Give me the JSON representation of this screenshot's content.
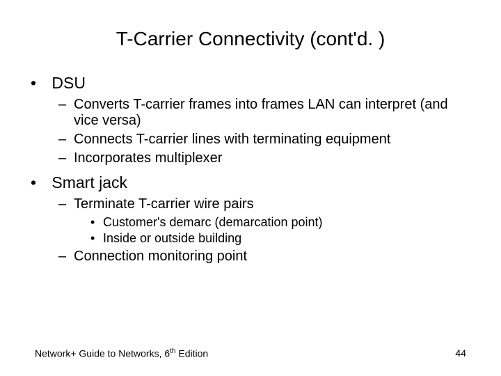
{
  "title": "T-Carrier Connectivity (cont'd. )",
  "bullets": [
    {
      "text": "DSU",
      "children": [
        {
          "text": "Converts T-carrier frames into frames LAN can interpret (and vice versa)"
        },
        {
          "text": "Connects T-carrier lines with terminating equipment"
        },
        {
          "text": "Incorporates multiplexer"
        }
      ]
    },
    {
      "text": "Smart jack",
      "children": [
        {
          "text": "Terminate T-carrier wire pairs",
          "children": [
            {
              "text": "Customer's demarc (demarcation point)"
            },
            {
              "text": "Inside or outside building"
            }
          ]
        },
        {
          "text": "Connection monitoring point"
        }
      ]
    }
  ],
  "footer": {
    "left_pre": "Network+ Guide to Networks, 6",
    "left_sup": "th",
    "left_post": " Edition",
    "right": "44"
  }
}
